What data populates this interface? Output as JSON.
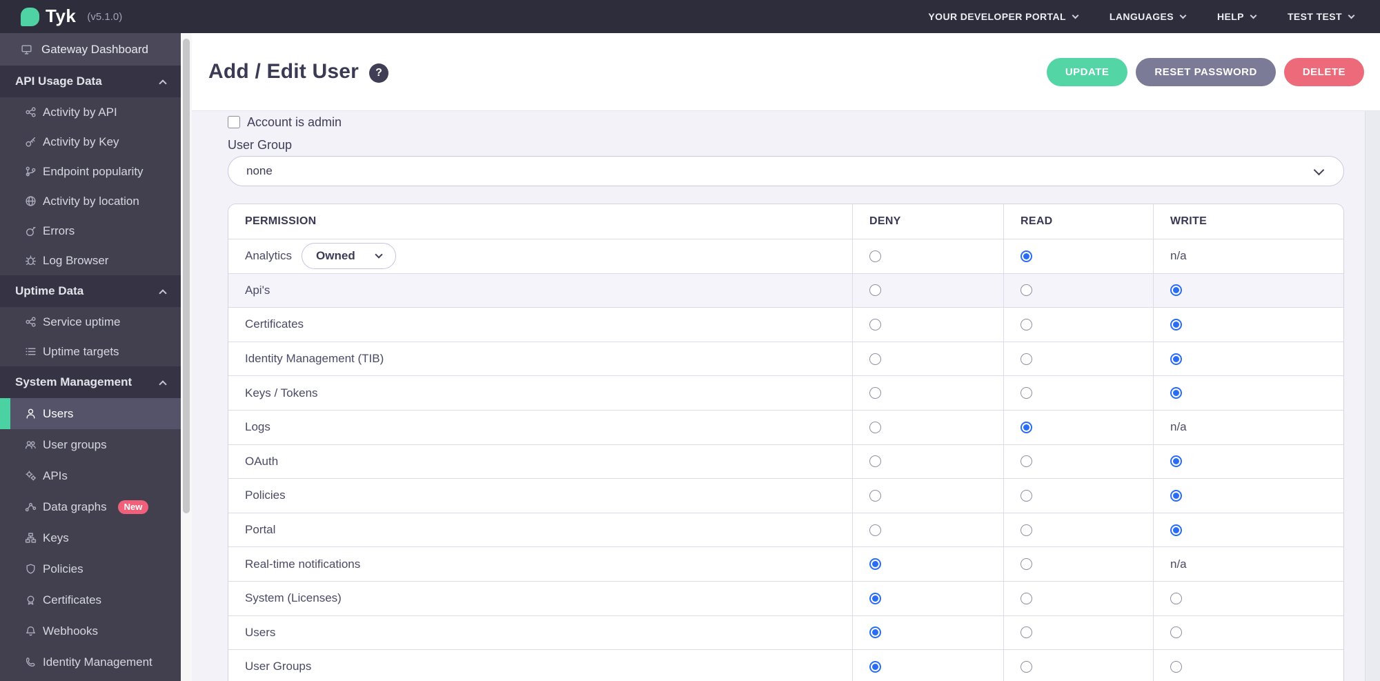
{
  "topbar": {
    "logo_text": "Tyk",
    "version": "(v5.1.0)",
    "menu": [
      {
        "label": "YOUR DEVELOPER PORTAL"
      },
      {
        "label": "LANGUAGES"
      },
      {
        "label": "HELP"
      },
      {
        "label": "TEST TEST"
      }
    ]
  },
  "sidebar": {
    "gateway_label": "Gateway Dashboard",
    "sections": [
      {
        "label": "API Usage Data",
        "items": [
          {
            "label": "Activity by API",
            "icon": "nodes-icon"
          },
          {
            "label": "Activity by Key",
            "icon": "key-icon"
          },
          {
            "label": "Endpoint popularity",
            "icon": "branch-icon"
          },
          {
            "label": "Activity by location",
            "icon": "globe-icon"
          },
          {
            "label": "Errors",
            "icon": "bomb-icon"
          },
          {
            "label": "Log Browser",
            "icon": "bug-icon"
          }
        ]
      },
      {
        "label": "Uptime Data",
        "items": [
          {
            "label": "Service uptime",
            "icon": "nodes-icon"
          },
          {
            "label": "Uptime targets",
            "icon": "list-icon"
          }
        ]
      },
      {
        "label": "System Management",
        "items": [
          {
            "label": "Users",
            "icon": "user-icon",
            "active": true
          },
          {
            "label": "User groups",
            "icon": "users-icon"
          },
          {
            "label": "APIs",
            "icon": "gears-icon"
          },
          {
            "label": "Data graphs",
            "icon": "graph-icon",
            "badge": "New"
          },
          {
            "label": "Keys",
            "icon": "sitemap-icon"
          },
          {
            "label": "Policies",
            "icon": "shield-icon"
          },
          {
            "label": "Certificates",
            "icon": "certificate-icon"
          },
          {
            "label": "Webhooks",
            "icon": "bell-icon"
          },
          {
            "label": "Identity Management",
            "icon": "phone-icon"
          }
        ]
      }
    ]
  },
  "header": {
    "title": "Add / Edit User",
    "help_icon": "?",
    "buttons": [
      {
        "label": "UPDATE",
        "color": "#54d5a6"
      },
      {
        "label": "RESET PASSWORD",
        "color": "#7b7a97"
      },
      {
        "label": "DELETE",
        "color": "#ec6a79"
      }
    ]
  },
  "form": {
    "admin_checkbox_label": "Account is admin",
    "admin_checked": false,
    "user_group_label": "User Group",
    "user_group_value": "none"
  },
  "permissions_table": {
    "columns": [
      "PERMISSION",
      "DENY",
      "READ",
      "WRITE"
    ],
    "na_text": "n/a",
    "analytics_select_value": "Owned",
    "rows": [
      {
        "permission": "Analytics",
        "deny": "off",
        "read": "on",
        "write": "na",
        "has_select": true
      },
      {
        "permission": "Api's",
        "deny": "off",
        "read": "off",
        "write": "on",
        "hover": true
      },
      {
        "permission": "Certificates",
        "deny": "off",
        "read": "off",
        "write": "on"
      },
      {
        "permission": "Identity Management (TIB)",
        "deny": "off",
        "read": "off",
        "write": "on"
      },
      {
        "permission": "Keys / Tokens",
        "deny": "off",
        "read": "off",
        "write": "on"
      },
      {
        "permission": "Logs",
        "deny": "off",
        "read": "on",
        "write": "na"
      },
      {
        "permission": "OAuth",
        "deny": "off",
        "read": "off",
        "write": "on"
      },
      {
        "permission": "Policies",
        "deny": "off",
        "read": "off",
        "write": "on"
      },
      {
        "permission": "Portal",
        "deny": "off",
        "read": "off",
        "write": "on"
      },
      {
        "permission": "Real-time notifications",
        "deny": "on",
        "read": "off",
        "write": "na"
      },
      {
        "permission": "System (Licenses)",
        "deny": "on",
        "read": "off",
        "write": "off"
      },
      {
        "permission": "Users",
        "deny": "on",
        "read": "off",
        "write": "off"
      },
      {
        "permission": "User Groups",
        "deny": "on",
        "read": "off",
        "write": "off"
      }
    ]
  },
  "colors": {
    "accent_teal": "#4fd3a4",
    "radio_selected": "#2a6df4",
    "badge_pink": "#f0607a",
    "topbar_bg": "#2e2d3b",
    "sidebar_bg": "#42404f",
    "update_button": "#54d5a6",
    "reset_button": "#7b7a97",
    "delete_button": "#ec6a79"
  }
}
